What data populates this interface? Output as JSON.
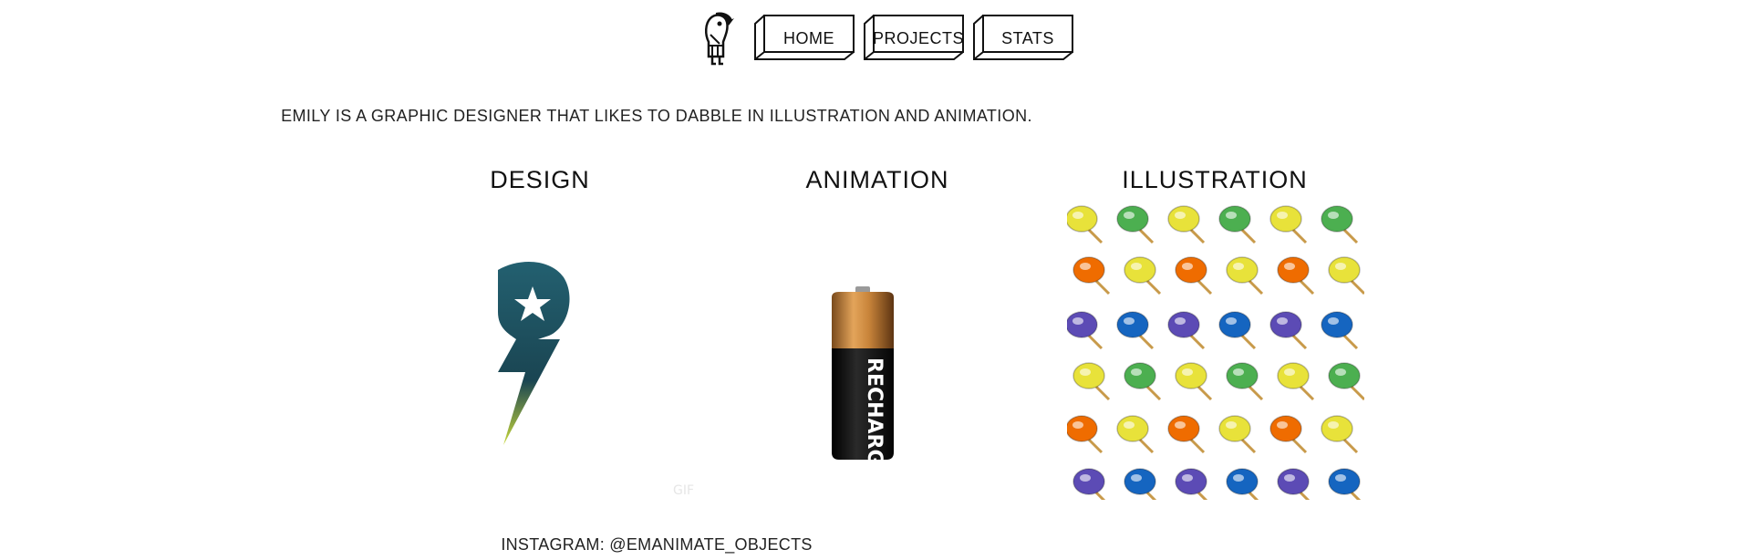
{
  "nav": {
    "home": "HOME",
    "projects": "PROJECTS",
    "stats": "STATS"
  },
  "intro": "EMILY IS A GRAPHIC DESIGNER THAT LIKES TO DABBLE IN ILLUSTRATION AND ANIMATION.",
  "sections": {
    "design": "DESIGN",
    "animation": "ANIMATION",
    "illustration": "ILLUSTRATION"
  },
  "battery_label": "RECHARGE",
  "footer": "INSTAGRAM: @EMANIMATE_OBJECTS",
  "colors": {
    "logo_teal": "#1f4f5a",
    "battery_copper": "#c8843a",
    "battery_body": "#151515"
  }
}
